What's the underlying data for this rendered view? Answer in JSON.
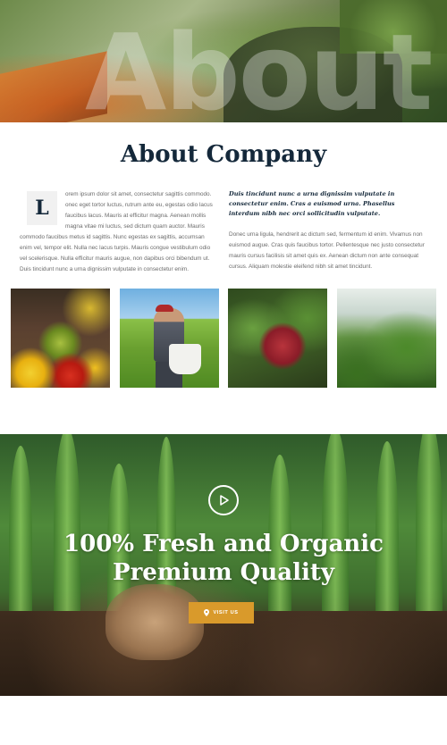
{
  "hero": {
    "watermark": "About"
  },
  "about": {
    "title": "About Company",
    "dropcap": "L",
    "left_paragraph_first": "orem ipsum dolor sit amet, consectetur sagittis commodo. onec eget tortor luctus, rutrum ante eu, egestas odio lacus faucibus lacus. Mauris at efficitur magna. Aenean mollis magna vitae mi luctus, sed dictum quam auctor. Mauris",
    "left_paragraph_rest": "commodo faucibus metus id sagittis. Nunc egestas ex sagittis, accumsan enim vel, tempor elit. Nulla nec lacus turpis. Mauris congue vestibulum odio vel scelerisque. Nulla efficitur mauris augue, non dapibus orci bibendum ut. Duis tincidunt nunc a urna dignissim vulputate in consectetur enim.",
    "right_emphasis": "Duis tincidunt nunc a urna dignissim vulputate in consectetur enim. Cras a euismod urna. Phasellus interdum nibh nec orci sollicitudin vulputate.",
    "right_paragraph": "Donec urna ligula, hendrerit ac dictum sed, fermentum id enim. Vivamus non euismod augue. Cras quis faucibus tortor. Pellentesque nec justo consectetur mauris cursus facilisis sit amet quis ex. Aenean dictum non ante consequat cursus. Aliquam molestie eleifend nibh sit amet tincidunt."
  },
  "gallery": {
    "images": [
      {
        "subject": "fruit-market-image"
      },
      {
        "subject": "farmer-image"
      },
      {
        "subject": "apple-tree-image"
      },
      {
        "subject": "greenhouse-image"
      }
    ]
  },
  "banner": {
    "play_icon": "play-icon",
    "title_line1": "100% Fresh and Organic",
    "title_line2": "Premium Quality",
    "button_label": "VISIT US",
    "button_icon": "map-pin-icon",
    "accent_color": "#d99a2b"
  }
}
